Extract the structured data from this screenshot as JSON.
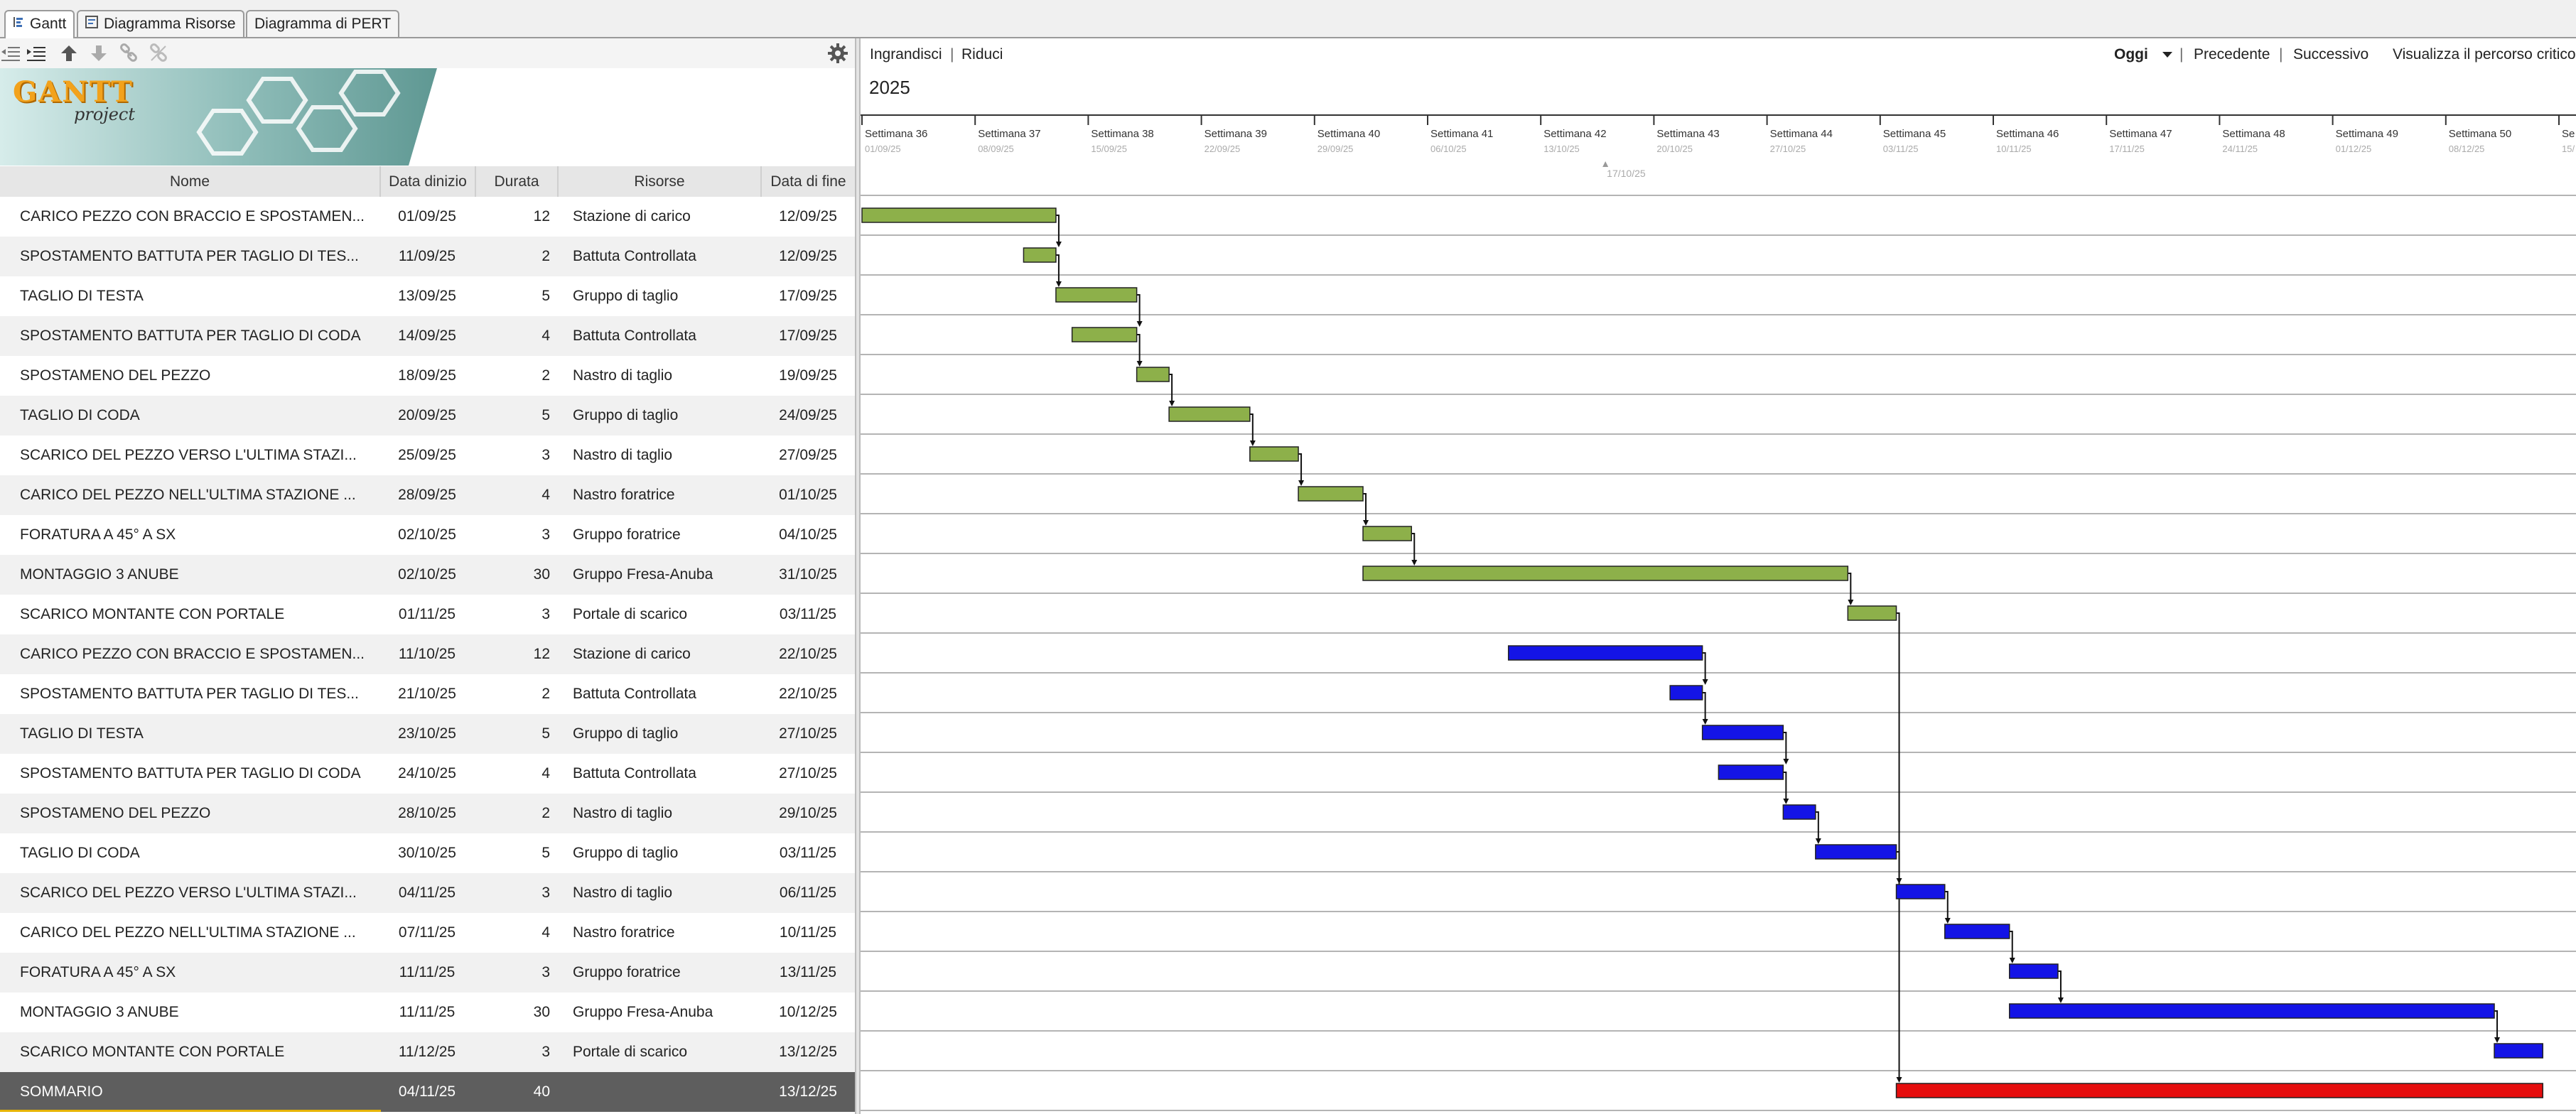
{
  "tabs": [
    {
      "label": "Gantt",
      "active": true,
      "icon": "gantt-icon"
    },
    {
      "label": "Diagramma Risorse",
      "active": false,
      "icon": "resource-chart-icon"
    },
    {
      "label": "Diagramma di PERT",
      "active": false,
      "icon": ""
    }
  ],
  "toolbar": {
    "icons": [
      "outdent-icon",
      "indent-icon",
      "move-up-icon",
      "move-down-icon",
      "link-icon",
      "unlink-icon"
    ],
    "settings_icon": "gear-icon"
  },
  "banner": {
    "logo_main": "GANTT",
    "logo_sub": "project"
  },
  "columns": {
    "name": "Nome",
    "start": "Data dinizio",
    "duration": "Durata",
    "resource": "Risorse",
    "end": "Data di fine"
  },
  "tasks": [
    {
      "name": "CARICO PEZZO CON BRACCIO E SPOSTAMEN...",
      "start": "01/09/25",
      "duration": "12",
      "resource": "Stazione di carico",
      "end": "12/09/25"
    },
    {
      "name": "SPOSTAMENTO BATTUTA PER TAGLIO DI TES...",
      "start": "11/09/25",
      "duration": "2",
      "resource": "Battuta Controllata",
      "end": "12/09/25"
    },
    {
      "name": "TAGLIO DI TESTA",
      "start": "13/09/25",
      "duration": "5",
      "resource": "Gruppo di taglio",
      "end": "17/09/25"
    },
    {
      "name": "SPOSTAMENTO BATTUTA PER TAGLIO DI CODA",
      "start": "14/09/25",
      "duration": "4",
      "resource": "Battuta Controllata",
      "end": "17/09/25"
    },
    {
      "name": "SPOSTAMENO DEL PEZZO",
      "start": "18/09/25",
      "duration": "2",
      "resource": "Nastro di taglio",
      "end": "19/09/25"
    },
    {
      "name": "TAGLIO DI CODA",
      "start": "20/09/25",
      "duration": "5",
      "resource": "Gruppo di taglio",
      "end": "24/09/25"
    },
    {
      "name": "SCARICO DEL PEZZO VERSO L'ULTIMA STAZI...",
      "start": "25/09/25",
      "duration": "3",
      "resource": "Nastro di taglio",
      "end": "27/09/25"
    },
    {
      "name": "CARICO DEL PEZZO NELL'ULTIMA STAZIONE ...",
      "start": "28/09/25",
      "duration": "4",
      "resource": "Nastro foratrice",
      "end": "01/10/25"
    },
    {
      "name": "FORATURA A 45° A SX",
      "start": "02/10/25",
      "duration": "3",
      "resource": "Gruppo foratrice",
      "end": "04/10/25"
    },
    {
      "name": "MONTAGGIO 3 ANUBE",
      "start": "02/10/25",
      "duration": "30",
      "resource": "Gruppo Fresa-Anuba",
      "end": "31/10/25"
    },
    {
      "name": "SCARICO MONTANTE CON PORTALE",
      "start": "01/11/25",
      "duration": "3",
      "resource": "Portale di scarico",
      "end": "03/11/25"
    },
    {
      "name": "CARICO PEZZO CON BRACCIO E SPOSTAMEN...",
      "start": "11/10/25",
      "duration": "12",
      "resource": "Stazione di carico",
      "end": "22/10/25"
    },
    {
      "name": "SPOSTAMENTO BATTUTA PER TAGLIO DI TES...",
      "start": "21/10/25",
      "duration": "2",
      "resource": "Battuta Controllata",
      "end": "22/10/25"
    },
    {
      "name": "TAGLIO DI TESTA",
      "start": "23/10/25",
      "duration": "5",
      "resource": "Gruppo di taglio",
      "end": "27/10/25"
    },
    {
      "name": "SPOSTAMENTO BATTUTA PER TAGLIO DI CODA",
      "start": "24/10/25",
      "duration": "4",
      "resource": "Battuta Controllata",
      "end": "27/10/25"
    },
    {
      "name": "SPOSTAMENO DEL PEZZO",
      "start": "28/10/25",
      "duration": "2",
      "resource": "Nastro di taglio",
      "end": "29/10/25"
    },
    {
      "name": "TAGLIO DI CODA",
      "start": "30/10/25",
      "duration": "5",
      "resource": "Gruppo di taglio",
      "end": "03/11/25"
    },
    {
      "name": "SCARICO DEL PEZZO VERSO L'ULTIMA STAZI...",
      "start": "04/11/25",
      "duration": "3",
      "resource": "Nastro di taglio",
      "end": "06/11/25"
    },
    {
      "name": "CARICO DEL PEZZO NELL'ULTIMA STAZIONE ...",
      "start": "07/11/25",
      "duration": "4",
      "resource": "Nastro foratrice",
      "end": "10/11/25"
    },
    {
      "name": "FORATURA A 45° A SX",
      "start": "11/11/25",
      "duration": "3",
      "resource": "Gruppo foratrice",
      "end": "13/11/25"
    },
    {
      "name": "MONTAGGIO 3 ANUBE",
      "start": "11/11/25",
      "duration": "30",
      "resource": "Gruppo Fresa-Anuba",
      "end": "10/12/25"
    },
    {
      "name": "SCARICO MONTANTE CON PORTALE",
      "start": "11/12/25",
      "duration": "3",
      "resource": "Portale di scarico",
      "end": "13/12/25"
    }
  ],
  "summary_row": {
    "name": "SOMMARIO",
    "start": "04/11/25",
    "duration": "40",
    "resource": "",
    "end": "13/12/25"
  },
  "chart_controls": {
    "zoom_in": "Ingrandisci",
    "zoom_out": "Riduci",
    "separator": "|",
    "today": "Oggi",
    "today_icon": "dropdown-arrow-icon",
    "previous": "Precedente",
    "next": "Successivo",
    "critical_path": "Visualizza il percorso critico"
  },
  "timeline": {
    "year": "2025",
    "weeks": [
      {
        "label": "Settimana 36",
        "date": "01/09/25"
      },
      {
        "label": "Settimana 37",
        "date": "08/09/25"
      },
      {
        "label": "Settimana 38",
        "date": "15/09/25"
      },
      {
        "label": "Settimana 39",
        "date": "22/09/25"
      },
      {
        "label": "Settimana 40",
        "date": "29/09/25"
      },
      {
        "label": "Settimana 41",
        "date": "06/10/25"
      },
      {
        "label": "Settimana 42",
        "date": "13/10/25"
      },
      {
        "label": "Settimana 43",
        "date": "20/10/25"
      },
      {
        "label": "Settimana 44",
        "date": "27/10/25"
      },
      {
        "label": "Settimana 45",
        "date": "03/11/25"
      },
      {
        "label": "Settimana 46",
        "date": "10/11/25"
      },
      {
        "label": "Settimana 47",
        "date": "17/11/25"
      },
      {
        "label": "Settimana 48",
        "date": "24/11/25"
      },
      {
        "label": "Settimana 49",
        "date": "01/12/25"
      },
      {
        "label": "Settimana 50",
        "date": "08/12/25"
      },
      {
        "label": "Se",
        "date": "15/"
      }
    ],
    "today_marker": "17/10/25"
  },
  "bars_days_from_sep1": [
    {
      "start": 0,
      "days": 12,
      "color": "green"
    },
    {
      "start": 10,
      "days": 2,
      "color": "green"
    },
    {
      "start": 12,
      "days": 5,
      "color": "green"
    },
    {
      "start": 13,
      "days": 4,
      "color": "green"
    },
    {
      "start": 17,
      "days": 2,
      "color": "green"
    },
    {
      "start": 19,
      "days": 5,
      "color": "green"
    },
    {
      "start": 24,
      "days": 3,
      "color": "green"
    },
    {
      "start": 27,
      "days": 4,
      "color": "green"
    },
    {
      "start": 31,
      "days": 3,
      "color": "green"
    },
    {
      "start": 31,
      "days": 30,
      "color": "green"
    },
    {
      "start": 61,
      "days": 3,
      "color": "green"
    },
    {
      "start": 40,
      "days": 12,
      "color": "blue"
    },
    {
      "start": 50,
      "days": 2,
      "color": "blue"
    },
    {
      "start": 52,
      "days": 5,
      "color": "blue"
    },
    {
      "start": 53,
      "days": 4,
      "color": "blue"
    },
    {
      "start": 57,
      "days": 2,
      "color": "blue"
    },
    {
      "start": 59,
      "days": 5,
      "color": "blue"
    },
    {
      "start": 64,
      "days": 3,
      "color": "blue"
    },
    {
      "start": 67,
      "days": 4,
      "color": "blue"
    },
    {
      "start": 71,
      "days": 3,
      "color": "blue"
    },
    {
      "start": 71,
      "days": 30,
      "color": "blue"
    },
    {
      "start": 101,
      "days": 3,
      "color": "blue"
    },
    {
      "start": 64,
      "days": 40,
      "color": "red"
    }
  ],
  "dependencies": [
    [
      0,
      1
    ],
    [
      1,
      2
    ],
    [
      2,
      3
    ],
    [
      3,
      4
    ],
    [
      4,
      5
    ],
    [
      5,
      6
    ],
    [
      6,
      7
    ],
    [
      7,
      8
    ],
    [
      8,
      9
    ],
    [
      9,
      10
    ],
    [
      10,
      22
    ],
    [
      11,
      12
    ],
    [
      12,
      13
    ],
    [
      13,
      14
    ],
    [
      14,
      15
    ],
    [
      15,
      16
    ],
    [
      16,
      17
    ],
    [
      17,
      18
    ],
    [
      18,
      19
    ],
    [
      19,
      20
    ],
    [
      20,
      21
    ]
  ],
  "colors": {
    "green": "#8db04a",
    "blue": "#1414e6",
    "red": "#e60d0d",
    "summary_row": "#5e5e5e",
    "accent": "#e7b400"
  }
}
